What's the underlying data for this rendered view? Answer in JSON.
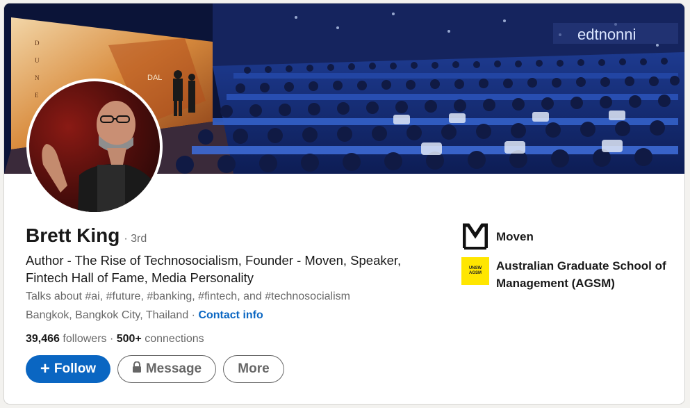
{
  "profile": {
    "name": "Brett King",
    "degree": "· 3rd",
    "headline": "Author - The Rise of Technosocialism, Founder - Moven, Speaker, Fintech Hall of Fame, Media Personality",
    "talks_about": "Talks about #ai, #future, #banking, #fintech, and #technosocialism",
    "location": "Bangkok, Bangkok City, Thailand",
    "location_sep": " · ",
    "contact_info": "Contact info"
  },
  "stats": {
    "followers_count": "39,466",
    "followers_label": " followers",
    "sep": " · ",
    "connections_count": "500+",
    "connections_label": " connections"
  },
  "actions": {
    "follow": "Follow",
    "message": "Message",
    "more": "More"
  },
  "organizations": [
    {
      "name": "Moven",
      "logo": "moven-logo"
    },
    {
      "name": "Australian Graduate School of Management (AGSM)",
      "logo": "unsw-agsm-logo",
      "logo_text": [
        "UNSW",
        "AGSM"
      ]
    }
  ],
  "banner": {
    "stage_letters": [
      "D",
      "U",
      "N",
      "E"
    ],
    "stage_caption": "DAL",
    "signage_text": "edtnonni"
  },
  "colors": {
    "accent": "#0a66c2",
    "agsm_yellow": "#ffe600"
  }
}
